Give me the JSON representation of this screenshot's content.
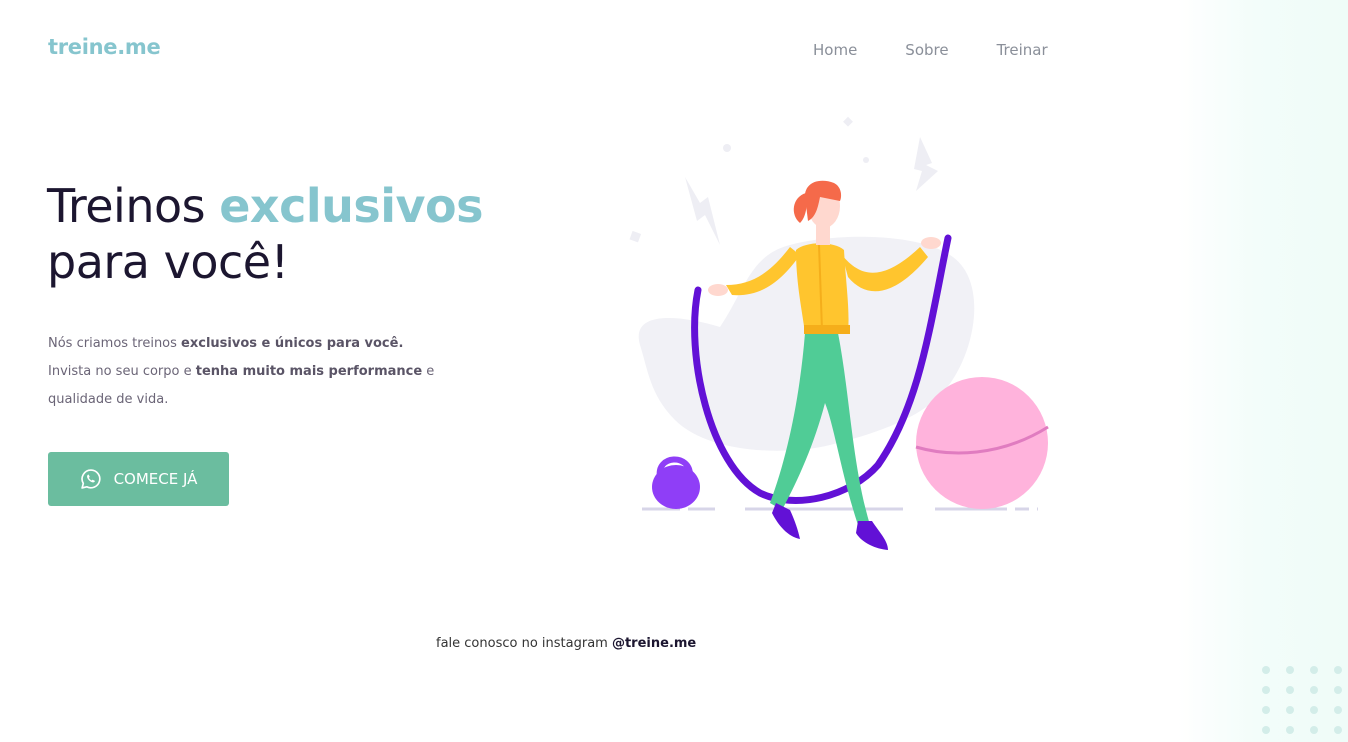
{
  "header": {
    "logo": "treine.me",
    "nav": [
      {
        "label": "Home"
      },
      {
        "label": "Sobre"
      },
      {
        "label": "Treinar"
      }
    ]
  },
  "hero": {
    "title_part1": "Treinos ",
    "title_accent": "exclusivos",
    "title_part2": "para você!",
    "text_1": "Nós criamos treinos ",
    "text_bold_1": "exclusivos e únicos para você.",
    "text_2": "Invista no seu corpo e ",
    "text_bold_2": "tenha muito mais performance",
    "text_3": " e qualidade de vida.",
    "cta_label": "COMECE JÁ",
    "cta_icon": "whatsapp-icon"
  },
  "illustration": {
    "name": "woman-jumping-rope-illustration"
  },
  "footer": {
    "text": "fale conosco no instagram ",
    "handle": "@treine.me"
  },
  "colors": {
    "accent": "#86c5ce",
    "button": "#6bbd9f",
    "heading": "#1c1630",
    "body_text": "#6b6577"
  }
}
